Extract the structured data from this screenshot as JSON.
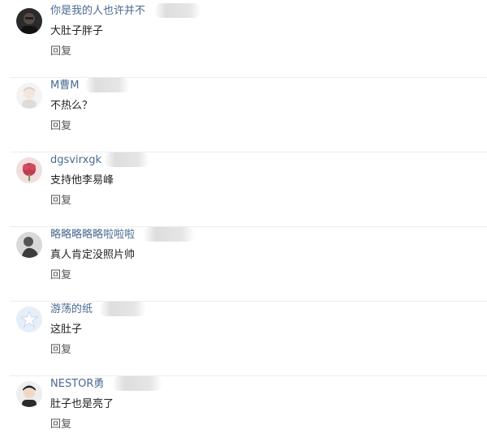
{
  "comments": [
    {
      "username": "你是我的人也许并不",
      "text": "大肚子胖子",
      "reply": "回复",
      "avatar_icon": "dark-portrait-avatar"
    },
    {
      "username": "M曹M",
      "text": "不热么？",
      "reply": "回复",
      "avatar_icon": "cartoon-boy-avatar"
    },
    {
      "username": "dgsvirxgk",
      "text": "支持他李易峰",
      "reply": "回复",
      "avatar_icon": "pink-flower-avatar"
    },
    {
      "username": "略略略略略啦啦啦",
      "text": "真人肯定没照片帅",
      "reply": "回复",
      "avatar_icon": "gray-figure-avatar"
    },
    {
      "username": "游荡的纸",
      "text": "这肚子",
      "reply": "回复",
      "avatar_icon": "star-default-avatar"
    },
    {
      "username": "NESTOR勇",
      "text": "肚子也是亮了",
      "reply": "回复",
      "avatar_icon": "young-man-avatar"
    }
  ],
  "colors": {
    "username": "#4a6a92",
    "text": "#222222",
    "reply": "#555555",
    "divider": "#ececec"
  }
}
